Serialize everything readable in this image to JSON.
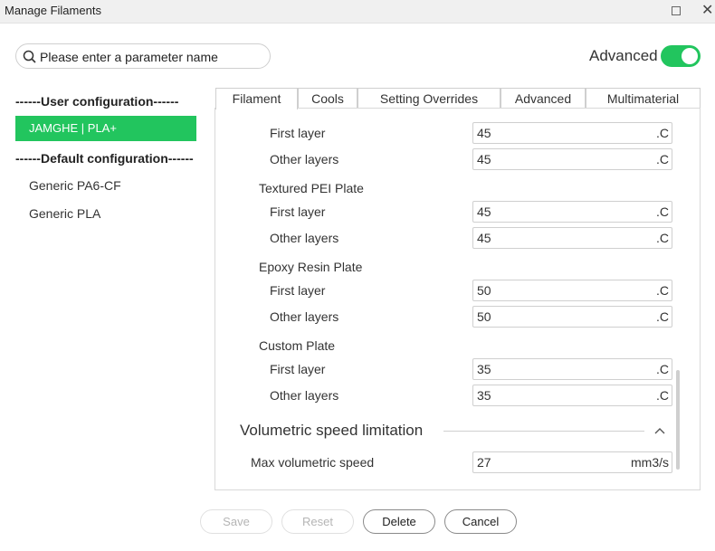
{
  "window": {
    "title": "Manage Filaments"
  },
  "search": {
    "placeholder": "Please enter a parameter name"
  },
  "advanced": {
    "label": "Advanced",
    "enabled": true
  },
  "sidebar": {
    "user_header": "------User configuration------",
    "user_items": [
      "JAMGHE | PLA+"
    ],
    "default_header": "------Default configuration------",
    "default_items": [
      "Generic PA6-CF",
      "Generic PLA"
    ]
  },
  "tabs": [
    "Filament",
    "Cools",
    "Setting Overrides",
    "Advanced",
    "Multimaterial"
  ],
  "active_tab": "Filament",
  "plates": [
    {
      "name": "",
      "rows": [
        {
          "label": "First layer",
          "value": "45",
          "unit": ".C"
        },
        {
          "label": "Other layers",
          "value": "45",
          "unit": ".C"
        }
      ]
    },
    {
      "name": "Textured PEI Plate",
      "rows": [
        {
          "label": "First layer",
          "value": "45",
          "unit": ".C"
        },
        {
          "label": "Other layers",
          "value": "45",
          "unit": ".C"
        }
      ]
    },
    {
      "name": "Epoxy Resin Plate",
      "rows": [
        {
          "label": "First layer",
          "value": "50",
          "unit": ".C"
        },
        {
          "label": "Other layers",
          "value": "50",
          "unit": ".C"
        }
      ]
    },
    {
      "name": "Custom Plate",
      "rows": [
        {
          "label": "First layer",
          "value": "35",
          "unit": ".C"
        },
        {
          "label": "Other layers",
          "value": "35",
          "unit": ".C"
        }
      ]
    }
  ],
  "volumetric": {
    "title": "Volumetric speed limitation",
    "row": {
      "label": "Max volumetric speed",
      "value": "27",
      "unit": "mm3/s"
    }
  },
  "buttons": {
    "save": "Save",
    "reset": "Reset",
    "delete": "Delete",
    "cancel": "Cancel"
  },
  "colors": {
    "accent": "#22c55e"
  }
}
